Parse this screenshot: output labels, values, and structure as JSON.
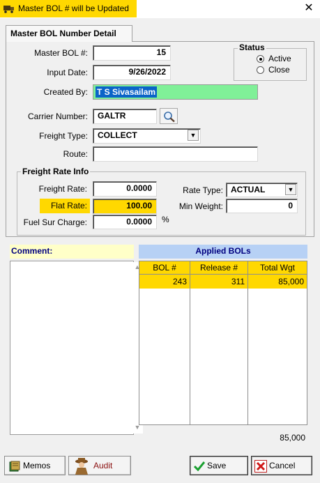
{
  "window": {
    "title": "Master BOL # will be Updated",
    "close_glyph": "✕",
    "accent": "#ffd800"
  },
  "tab": {
    "label": "Master BOL Number Detail"
  },
  "form": {
    "master_bol_label": "Master BOL #:",
    "master_bol_value": "15",
    "input_date_label": "Input Date:",
    "input_date_value": "9/26/2022",
    "created_by_label": "Created By:",
    "created_by_value": "T S Sivasailam",
    "carrier_label": "Carrier Number:",
    "carrier_value": "GALTR",
    "freight_type_label": "Freight Type:",
    "freight_type_value": "COLLECT",
    "route_label": "Route:",
    "route_value": ""
  },
  "status": {
    "title": "Status",
    "options": [
      "Active",
      "Close"
    ],
    "selected": "Active"
  },
  "freight_rate": {
    "title": "Freight Rate Info",
    "freight_rate_label": "Freight Rate:",
    "freight_rate_value": "0.0000",
    "flat_rate_label": "Flat Rate:",
    "flat_rate_value": "100.00",
    "fuel_label": "Fuel Sur Charge:",
    "fuel_value": "0.0000",
    "percent": "%",
    "rate_type_label": "Rate Type:",
    "rate_type_value": "ACTUAL",
    "min_weight_label": "Min Weight:",
    "min_weight_value": "0"
  },
  "comment": {
    "label": "Comment:",
    "text": ""
  },
  "applied_bols": {
    "title": "Applied BOLs",
    "columns": [
      "BOL #",
      "Release #",
      "Total Wgt"
    ],
    "rows": [
      [
        "243",
        "311",
        "85,000"
      ]
    ],
    "total": "85,000"
  },
  "buttons": {
    "memos": "Memos",
    "audit": "Audit",
    "save": "Save",
    "cancel": "Cancel"
  },
  "icons": {
    "search": "magnifier-icon",
    "dropdown": "▼",
    "scroll_up": "▲",
    "scroll_down": "▼"
  }
}
